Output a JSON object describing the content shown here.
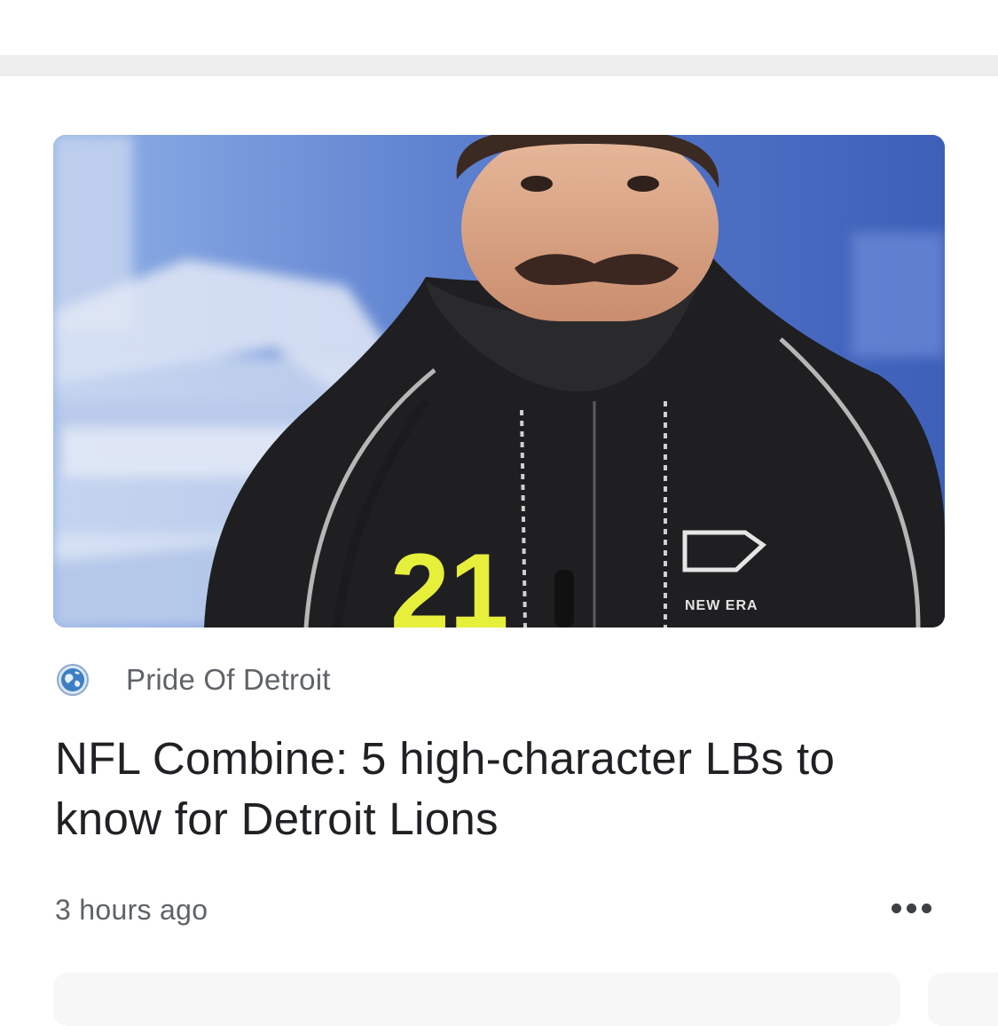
{
  "article": {
    "image_alt": "Linebacker in black hoodie with number 21 speaking at NFL Combine podium",
    "source": "Pride Of Detroit",
    "source_icon": "globe-icon",
    "headline": "NFL Combine: 5 high-character LBs to know for Detroit Lions",
    "time_ago": "3 hours ago",
    "more_icon": "more-horizontal-icon"
  },
  "colors": {
    "divider": "#eeeeee",
    "headline": "#202124",
    "secondary_text": "#5f6368",
    "jersey_number": "#e6ef3a"
  }
}
